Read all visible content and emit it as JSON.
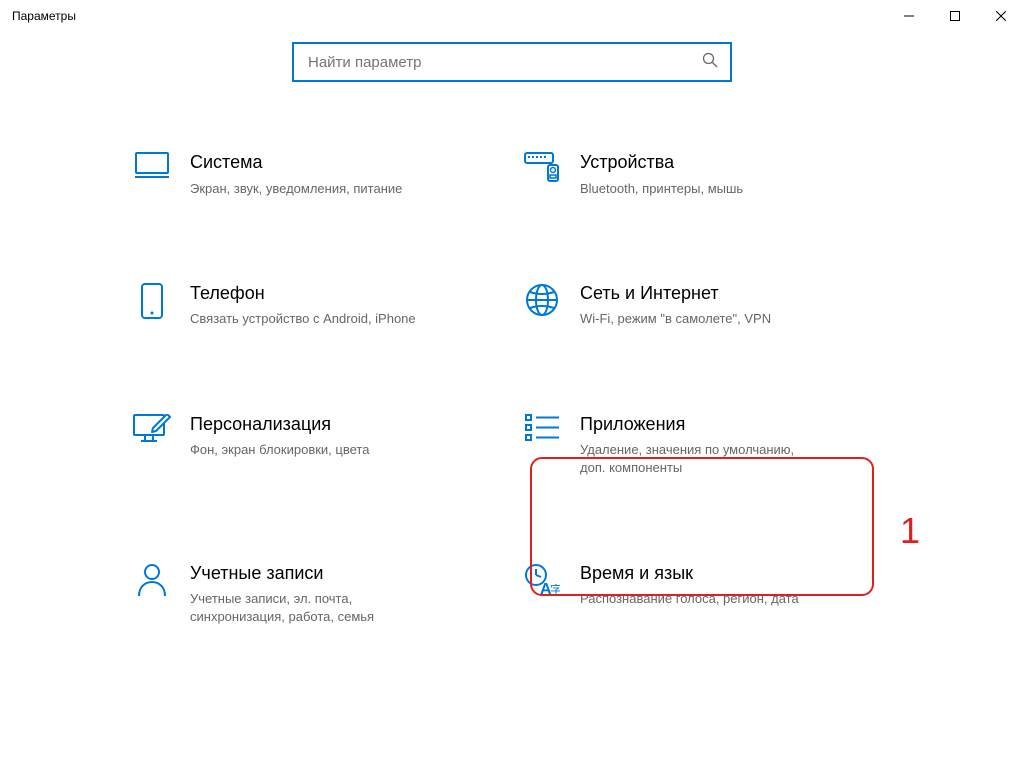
{
  "window": {
    "title": "Параметры"
  },
  "search": {
    "placeholder": "Найти параметр"
  },
  "categories": [
    {
      "title": "Система",
      "desc": "Экран, звук, уведомления, питание"
    },
    {
      "title": "Устройства",
      "desc": "Bluetooth, принтеры, мышь"
    },
    {
      "title": "Телефон",
      "desc": "Связать устройство с Android, iPhone"
    },
    {
      "title": "Сеть и Интернет",
      "desc": "Wi-Fi, режим \"в самолете\", VPN"
    },
    {
      "title": "Персонализация",
      "desc": "Фон, экран блокировки, цвета"
    },
    {
      "title": "Приложения",
      "desc": "Удаление, значения по умолчанию, доп. компоненты"
    },
    {
      "title": "Учетные записи",
      "desc": "Учетные записи, эл. почта, синхронизация, работа, семья"
    },
    {
      "title": "Время и язык",
      "desc": "Распознавание голоса, регион, дата"
    }
  ],
  "annotation": {
    "label": "1"
  }
}
